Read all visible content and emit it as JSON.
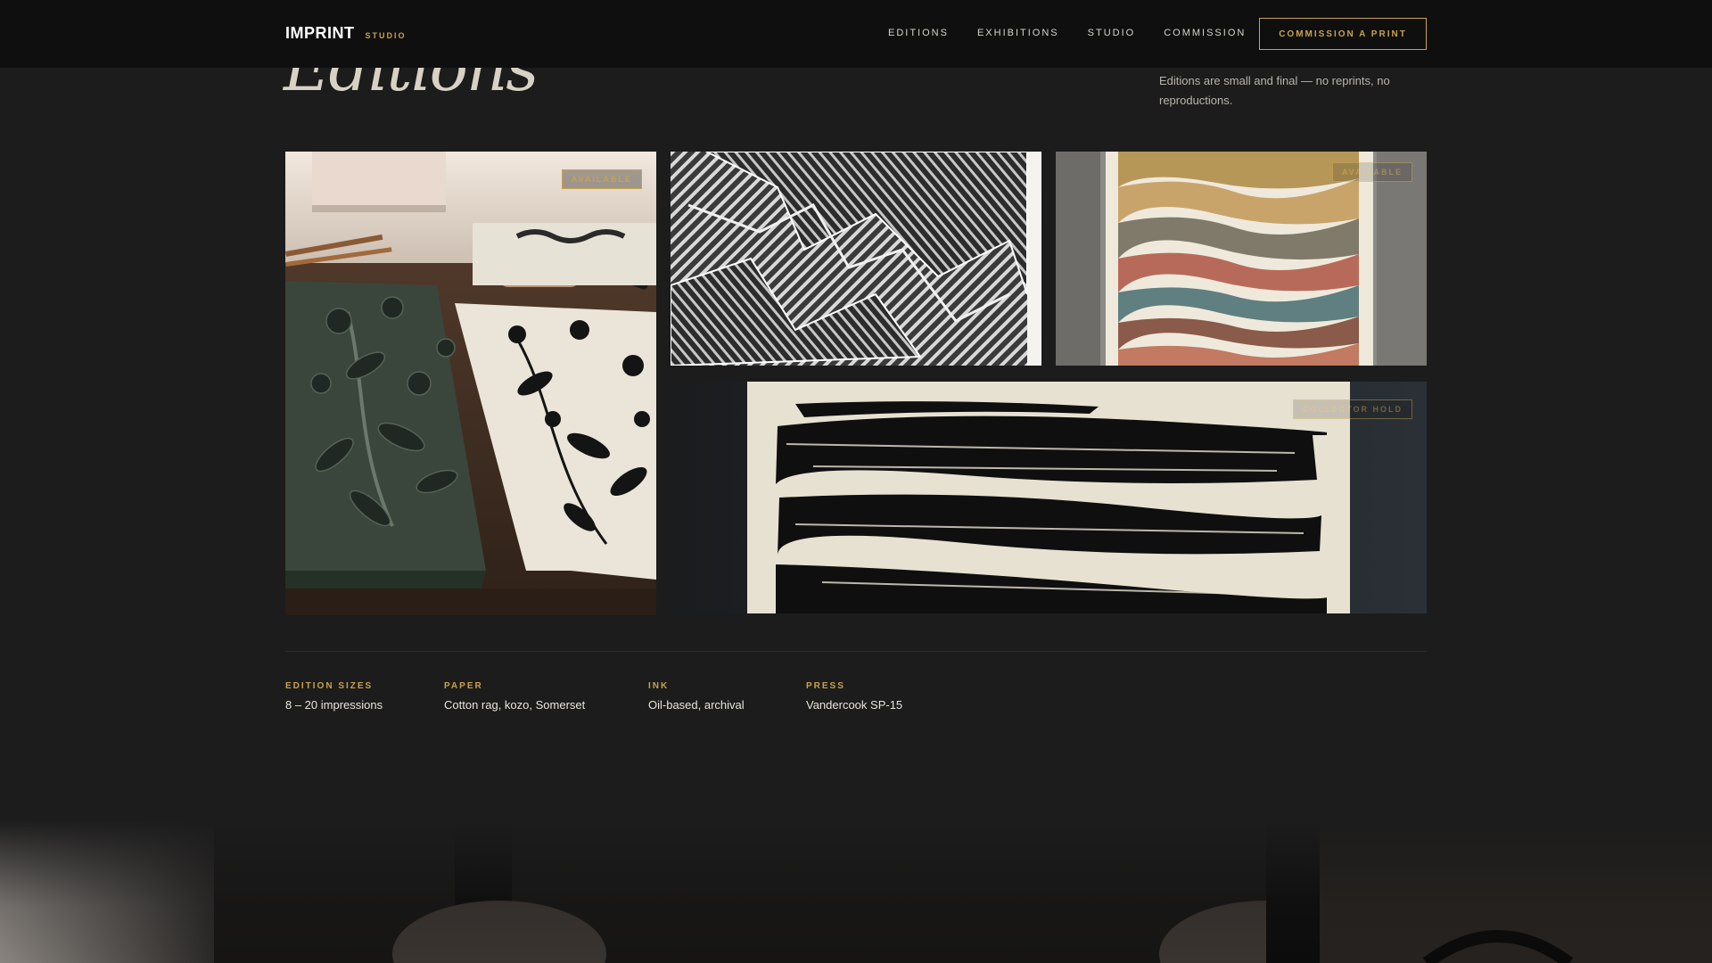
{
  "header": {
    "brand": "IMPRINT",
    "brand_sub": "STUDIO",
    "nav": [
      "EDITIONS",
      "EXHIBITIONS",
      "STUDIO",
      "COMMISSION"
    ],
    "cta": "COMMISSION A PRINT"
  },
  "hero": {
    "title": "Editions",
    "intro": "Editions are small and final — no reprints, no reproductions."
  },
  "works": [
    {
      "badge": "AVAILABLE"
    },
    {
      "badge": ""
    },
    {
      "badge": "AVAILABLE"
    },
    {
      "badge": "COLLECTOR HOLD"
    }
  ],
  "specs": [
    {
      "label": "EDITION SIZES",
      "value": "8 – 20 impressions"
    },
    {
      "label": "PAPER",
      "value": "Cotton rag, kozo, Somerset"
    },
    {
      "label": "INK",
      "value": "Oil-based, archival"
    },
    {
      "label": "PRESS",
      "value": "Vandercook SP-15"
    }
  ],
  "colors": {
    "accent": "#c9a24a",
    "background": "#1c1c1c",
    "header": "#0f0f0f"
  }
}
